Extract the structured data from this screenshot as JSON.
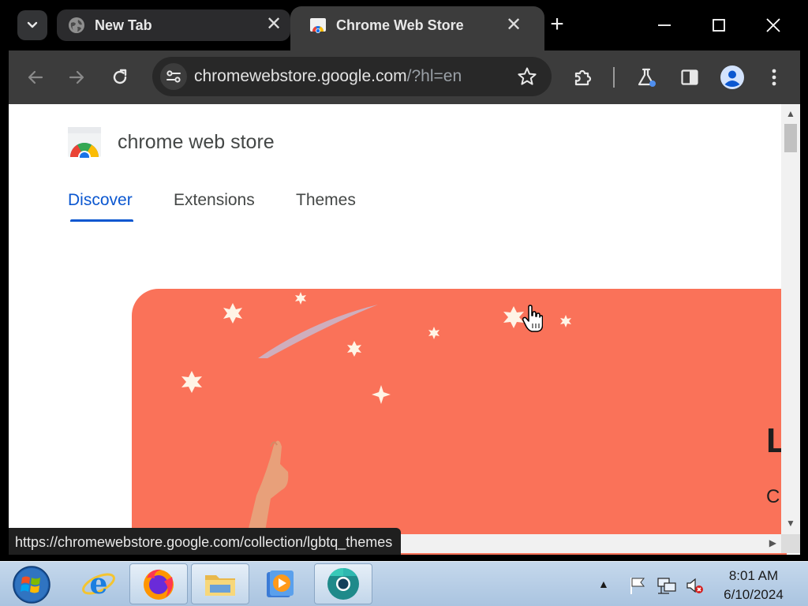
{
  "browser": {
    "tabs": [
      {
        "title": "New Tab",
        "icon": "globe-icon",
        "active": false
      },
      {
        "title": "Chrome Web Store",
        "icon": "chrome-web-store-icon",
        "active": true
      }
    ],
    "omnibox": {
      "host": "chromewebstore.google.com",
      "path": "/?hl=en"
    },
    "status_url": "https://chromewebstore.google.com/collection/lgbtq_themes"
  },
  "page": {
    "store_name": "chrome web store",
    "nav": [
      {
        "label": "Discover",
        "active": true
      },
      {
        "label": "Extensions",
        "active": false
      },
      {
        "label": "Themes",
        "active": false
      }
    ],
    "hero": {
      "background": "#fa7259",
      "title_partial": "L",
      "subtitle_partial": "C"
    }
  },
  "taskbar": {
    "apps": [
      {
        "name": "Internet Explorer",
        "icon": "internet-explorer-icon"
      },
      {
        "name": "Firefox",
        "icon": "firefox-icon"
      },
      {
        "name": "File Explorer",
        "icon": "folder-icon"
      },
      {
        "name": "Media Player",
        "icon": "media-player-icon"
      },
      {
        "name": "Chrome Beta",
        "icon": "chrome-icon"
      }
    ],
    "clock": {
      "time": "8:01 AM",
      "date": "6/10/2024"
    }
  },
  "colors": {
    "accent_blue": "#0b57d0",
    "hero_coral": "#fa7259"
  }
}
